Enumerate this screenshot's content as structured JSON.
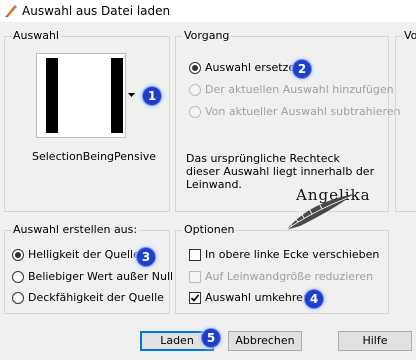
{
  "window": {
    "title": "Auswahl aus Datei laden"
  },
  "auswahl": {
    "legend": "Auswahl",
    "selection_name": "SelectionBeingPensive"
  },
  "vorgang": {
    "legend": "Vorgang",
    "options": [
      {
        "label": "Auswahl ersetzen",
        "selected": true,
        "enabled": true
      },
      {
        "label": "Der aktuellen Auswahl hinzufügen",
        "selected": false,
        "enabled": false
      },
      {
        "label": "Von aktueller Auswahl subtrahieren",
        "selected": false,
        "enabled": false
      }
    ],
    "info": "Das ursprüngliche Rechteck dieser Auswahl liegt innerhalb der Leinwand."
  },
  "right_group": {
    "legend": "Vo"
  },
  "watermark": {
    "text": "Angelika"
  },
  "erstellen": {
    "legend": "Auswahl erstellen aus:",
    "options": [
      {
        "label": "Helligkeit der Quelle",
        "selected": true
      },
      {
        "label": "Beliebiger Wert außer Null",
        "selected": false
      },
      {
        "label": "Deckfähigkeit der Quelle",
        "selected": false
      }
    ]
  },
  "optionen": {
    "legend": "Optionen",
    "items": [
      {
        "label": "In obere linke Ecke verschieben",
        "checked": false,
        "enabled": true
      },
      {
        "label": "Auf Leinwandgröße reduzieren",
        "checked": false,
        "enabled": false
      },
      {
        "label": "Auswahl umkehren",
        "checked": true,
        "enabled": true
      }
    ]
  },
  "buttons": {
    "load": "Laden",
    "cancel": "Abbrechen",
    "help": "Hilfe"
  },
  "badges": [
    "1",
    "2",
    "3",
    "4",
    "5"
  ],
  "colors": {
    "badge": "#1f3fc9",
    "default_button_border": "#0078d7"
  }
}
